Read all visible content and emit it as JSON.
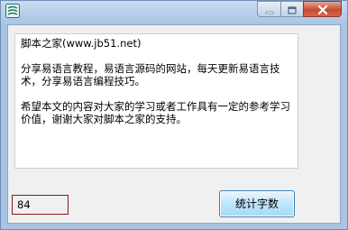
{
  "window": {
    "icon": "app-logo-icon",
    "controls": {
      "minimize_icon": "minimize-icon",
      "maximize_icon": "maximize-icon",
      "close_icon": "close-icon"
    }
  },
  "editor": {
    "paragraphs": [
      "脚本之家(www.jb51.net)",
      "分享易语言教程，易语言源码的网站，每天更新易语言技术，分享易语言编程技巧。",
      "希望本文的内容对大家的学习或者工作具有一定的参考学习价值，谢谢大家对脚本之家的支持。"
    ]
  },
  "count_field": {
    "value": "84"
  },
  "count_button": {
    "label": "统计字数"
  },
  "colors": {
    "title_bar": "#a9c4e3",
    "close_button": "#c74a33",
    "count_field_border": "#8b1a1a",
    "button_border": "#3c7fb1"
  }
}
